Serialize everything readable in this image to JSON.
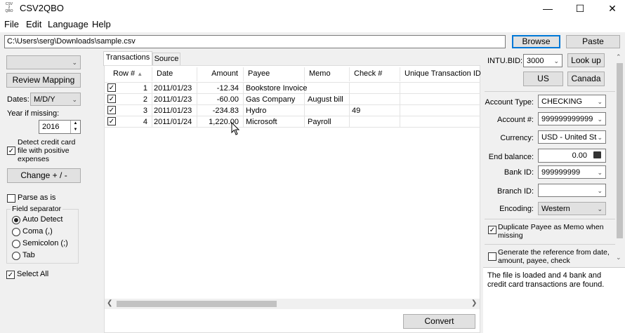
{
  "window": {
    "title": "CSV2QBO",
    "minimize_glyph": "—",
    "maximize_glyph": "☐",
    "close_glyph": "✕"
  },
  "menu": [
    "File",
    "Edit",
    "Language",
    "Help"
  ],
  "file_path": "C:\\Users\\serg\\Downloads\\sample.csv",
  "buttons": {
    "browse": "Browse",
    "paste": "Paste",
    "review_mapping": "Review Mapping",
    "change_sign": "Change + / -",
    "look_up": "Look up",
    "us": "US",
    "canada": "Canada",
    "convert": "Convert"
  },
  "left": {
    "dates_label": "Dates:",
    "dates_value": "M/D/Y",
    "year_label": "Year if missing:",
    "year_value": "2016",
    "detect_cc_label": "Detect credit card file with positive expenses",
    "parse_as_is": "Parse as is",
    "field_separator": "Field separator",
    "separators": [
      "Auto Detect",
      "Coma (,)",
      "Semicolon (;)",
      "Tab"
    ],
    "select_all": "Select All"
  },
  "tabs": [
    "Transactions",
    "Source"
  ],
  "table": {
    "columns": [
      "Row #",
      "Date",
      "Amount",
      "Payee",
      "Memo",
      "Check #",
      "Unique Transaction ID"
    ],
    "rows": [
      {
        "row": "1",
        "date": "2011/01/23",
        "amount": "-12.34",
        "payee": "Bookstore Invoice",
        "memo": "",
        "check": ""
      },
      {
        "row": "2",
        "date": "2011/01/23",
        "amount": "-60.00",
        "payee": "Gas Company",
        "memo": "August bill",
        "check": ""
      },
      {
        "row": "3",
        "date": "2011/01/23",
        "amount": "-234.83",
        "payee": "Hydro",
        "memo": "",
        "check": "49"
      },
      {
        "row": "4",
        "date": "2011/01/24",
        "amount": "1,220.00",
        "payee": "Microsoft",
        "memo": "Payroll",
        "check": ""
      }
    ]
  },
  "right": {
    "intu_bid_label": "INTU.BID:",
    "intu_bid_value": "3000",
    "account_type_label": "Account Type:",
    "account_type_value": "CHECKING",
    "account_no_label": "Account #:",
    "account_no_value": "999999999999",
    "currency_label": "Currency:",
    "currency_value": "USD - United Sta",
    "end_balance_label": "End balance:",
    "end_balance_value": "0.00",
    "bank_id_label": "Bank ID:",
    "bank_id_value": "999999999",
    "branch_id_label": "Branch ID:",
    "branch_id_value": "",
    "encoding_label": "Encoding:",
    "encoding_value": "Western",
    "dup_payee_label": "Duplicate Payee as Memo when missing",
    "generate_ref_label": "Generate the reference from date, amount, payee, check"
  },
  "status": "The file is loaded and 4 bank and credit card transactions are found."
}
